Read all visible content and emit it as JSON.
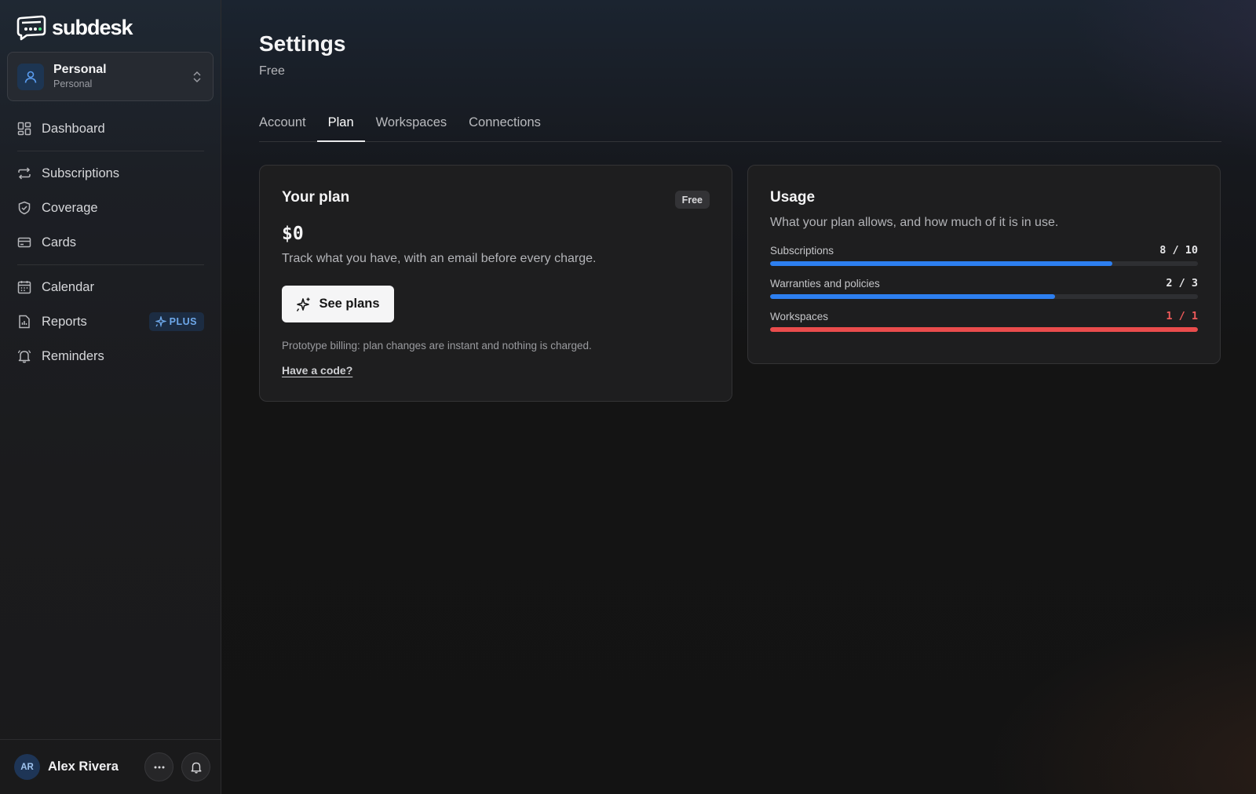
{
  "brand": {
    "name": "subdesk"
  },
  "workspace": {
    "name": "Personal",
    "type": "Personal"
  },
  "nav": {
    "items": [
      {
        "id": "dashboard",
        "label": "Dashboard",
        "icon": "dashboard-icon"
      },
      {
        "id": "subscriptions",
        "label": "Subscriptions",
        "icon": "repeat-icon"
      },
      {
        "id": "coverage",
        "label": "Coverage",
        "icon": "shield-icon"
      },
      {
        "id": "cards",
        "label": "Cards",
        "icon": "credit-card-icon"
      },
      {
        "id": "calendar",
        "label": "Calendar",
        "icon": "calendar-icon"
      },
      {
        "id": "reports",
        "label": "Reports",
        "icon": "report-icon",
        "badge": "PLUS"
      },
      {
        "id": "reminders",
        "label": "Reminders",
        "icon": "bell-icon"
      }
    ]
  },
  "user": {
    "initials": "AR",
    "name": "Alex Rivera"
  },
  "page": {
    "title": "Settings",
    "subtitle": "Free"
  },
  "tabs": [
    {
      "label": "Account",
      "active": false
    },
    {
      "label": "Plan",
      "active": true
    },
    {
      "label": "Workspaces",
      "active": false
    },
    {
      "label": "Connections",
      "active": false
    }
  ],
  "plan": {
    "title": "Your plan",
    "badge": "Free",
    "price": "$0",
    "description": "Track what you have, with an email before every charge.",
    "button_label": "See plans",
    "note": "Prototype billing: plan changes are instant and nothing is charged.",
    "code_link": "Have a code?"
  },
  "usage": {
    "title": "Usage",
    "description": "What your plan allows, and how much of it is in use.",
    "items": [
      {
        "label": "Subscriptions",
        "used": 8,
        "limit": 10,
        "display": "8 / 10",
        "full": false
      },
      {
        "label": "Warranties and policies",
        "used": 2,
        "limit": 3,
        "display": "2 / 3",
        "full": false
      },
      {
        "label": "Workspaces",
        "used": 1,
        "limit": 1,
        "display": "1 / 1",
        "full": true
      }
    ]
  },
  "colors": {
    "accent_blue": "#2d7ff0",
    "limit_red": "#ea4c4c",
    "plus_badge": "#6ea8ea"
  }
}
